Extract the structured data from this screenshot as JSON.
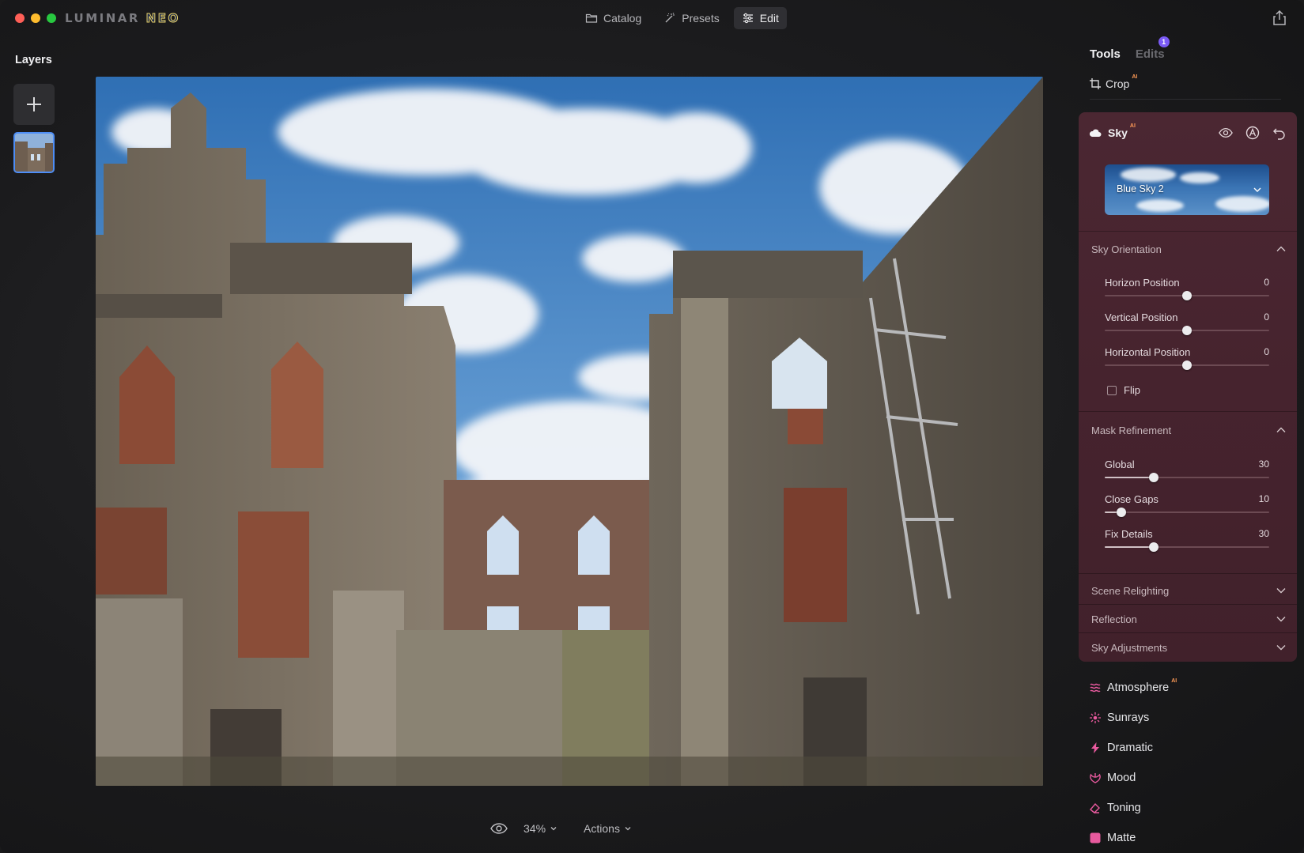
{
  "app": {
    "logo_part1": "LUMINAR",
    "logo_part2": "NEO"
  },
  "topnav": {
    "catalog": "Catalog",
    "presets": "Presets",
    "edit": "Edit"
  },
  "layers": {
    "title": "Layers"
  },
  "bottombar": {
    "zoom": "34%",
    "actions": "Actions"
  },
  "rightpanel": {
    "tab_tools": "Tools",
    "tab_edits": "Edits",
    "edits_badge": "1",
    "crop_label": "Crop",
    "ai_tag": "AI",
    "sky": {
      "title": "Sky",
      "ai_tag": "AI",
      "preset_name": "Blue Sky 2",
      "sky_orientation": {
        "title": "Sky Orientation",
        "sliders": [
          {
            "label": "Horizon Position",
            "value": "0",
            "fraction": 0.5
          },
          {
            "label": "Vertical Position",
            "value": "0",
            "fraction": 0.5
          },
          {
            "label": "Horizontal Position",
            "value": "0",
            "fraction": 0.5
          }
        ],
        "flip_label": "Flip"
      },
      "mask_refinement": {
        "title": "Mask Refinement",
        "sliders": [
          {
            "label": "Global",
            "value": "30",
            "fraction": 0.3
          },
          {
            "label": "Close Gaps",
            "value": "10",
            "fraction": 0.1
          },
          {
            "label": "Fix Details",
            "value": "30",
            "fraction": 0.3
          }
        ]
      },
      "collapsed_sections": [
        "Scene Relighting",
        "Reflection",
        "Sky Adjustments"
      ]
    },
    "tools": [
      {
        "label": "Atmosphere",
        "ai": "AI",
        "icon": "atmosphere-icon",
        "color": "#e85a9e"
      },
      {
        "label": "Sunrays",
        "ai": "",
        "icon": "sunrays-icon",
        "color": "#e85a9e"
      },
      {
        "label": "Dramatic",
        "ai": "",
        "icon": "dramatic-icon",
        "color": "#e85a9e"
      },
      {
        "label": "Mood",
        "ai": "",
        "icon": "mood-icon",
        "color": "#e85a9e"
      },
      {
        "label": "Toning",
        "ai": "",
        "icon": "toning-icon",
        "color": "#e85a9e"
      },
      {
        "label": "Matte",
        "ai": "",
        "icon": "matte-icon",
        "color": "#e85a9e"
      }
    ]
  },
  "colors": {
    "accent": "#4d8df6",
    "sky_panel": "#4b2732",
    "badge": "#7a5af5",
    "ai_tag": "#ff9b57"
  }
}
